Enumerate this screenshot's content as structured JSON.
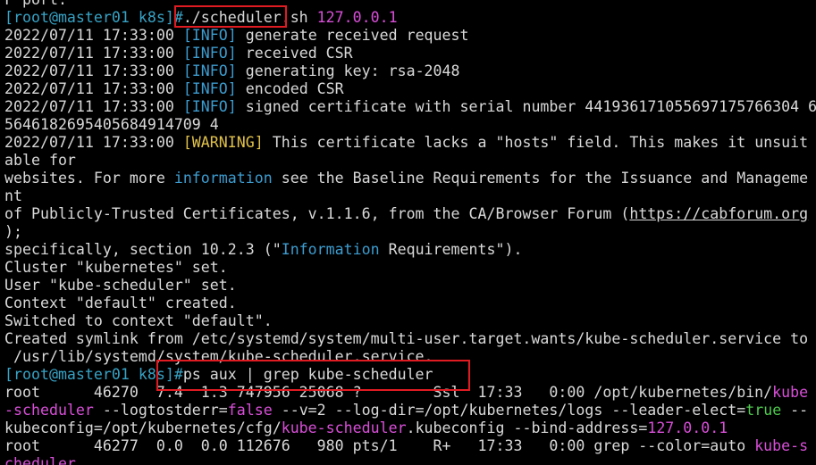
{
  "terminal": {
    "lines": [
      [
        {
          "t": "F port:"
        }
      ],
      [
        {
          "t": "[root@master01 k8s]#",
          "c": "cyan"
        },
        {
          "t": "./scheduler.sh "
        },
        {
          "t": "127.0.0.1",
          "c": "mag"
        }
      ],
      [
        {
          "t": "2022/07/11 17:33:00 "
        },
        {
          "t": "[INFO]",
          "c": "blue"
        },
        {
          "t": " generate received request"
        }
      ],
      [
        {
          "t": "2022/07/11 17:33:00 "
        },
        {
          "t": "[INFO]",
          "c": "blue"
        },
        {
          "t": " received CSR"
        }
      ],
      [
        {
          "t": "2022/07/11 17:33:00 "
        },
        {
          "t": "[INFO]",
          "c": "blue"
        },
        {
          "t": " generating key: rsa-2048"
        }
      ],
      [
        {
          "t": "2022/07/11 17:33:00 "
        },
        {
          "t": "[INFO]",
          "c": "blue"
        },
        {
          "t": " encoded CSR"
        }
      ],
      [
        {
          "t": "2022/07/11 17:33:00 "
        },
        {
          "t": "[INFO]",
          "c": "blue"
        },
        {
          "t": " signed certificate with serial number 441936171055697175766304 6"
        }
      ],
      [
        {
          "t": "5646182695405684914709 4"
        }
      ],
      [
        {
          "t": "2022/07/11 17:33:00 "
        },
        {
          "t": "[WARNING]",
          "c": "yel"
        },
        {
          "t": " This certificate lacks a \"hosts\" field. This makes it unsuit"
        }
      ],
      [
        {
          "t": "able for"
        }
      ],
      [
        {
          "t": "websites. For more "
        },
        {
          "t": "information",
          "c": "blue"
        },
        {
          "t": " see the Baseline Requirements for the Issuance and Manageme"
        }
      ],
      [
        {
          "t": "nt"
        }
      ],
      [
        {
          "t": "of Publicly-Trusted Certificates, v.1.1.6, from the CA/Browser Forum ("
        },
        {
          "t": "https://cabforum.org",
          "c": "ul"
        }
      ],
      [
        {
          "t": ");"
        }
      ],
      [
        {
          "t": "specifically, section 10.2.3 (\""
        },
        {
          "t": "Information",
          "c": "blue"
        },
        {
          "t": " Requirements\")."
        }
      ],
      [
        {
          "t": "Cluster \"kubernetes\" set."
        }
      ],
      [
        {
          "t": "User \"kube-scheduler\" set."
        }
      ],
      [
        {
          "t": "Context \"default\" created."
        }
      ],
      [
        {
          "t": "Switched to context \"default\"."
        }
      ],
      [
        {
          "t": "Created symlink from /etc/systemd/system/multi-user.target.wants/kube-scheduler.service to"
        }
      ],
      [
        {
          "t": " /usr/lib/systemd/system/kube-scheduler.service."
        }
      ],
      [
        {
          "t": "[root@master01 k8s]#",
          "c": "cyan"
        },
        {
          "t": "ps aux | grep kube-scheduler"
        }
      ],
      [
        {
          "t": "root      46270  7.4  1.3 747956 25068 ?        Ssl  17:33   0:00 /opt/kubernetes/bin/"
        },
        {
          "t": "kube",
          "c": "mag"
        }
      ],
      [
        {
          "t": "-scheduler",
          "c": "mag"
        },
        {
          "t": " --logtostderr="
        },
        {
          "t": "false",
          "c": "mag"
        },
        {
          "t": " --v=2 --log-dir=/opt/kubernetes/logs --leader-elect="
        },
        {
          "t": "true",
          "c": "green"
        },
        {
          "t": " --"
        }
      ],
      [
        {
          "t": "kubeconfig=/opt/kubernetes/cfg/"
        },
        {
          "t": "kube-scheduler",
          "c": "mag"
        },
        {
          "t": ".kubeconfig --bind-address="
        },
        {
          "t": "127.0.0.1",
          "c": "mag"
        }
      ],
      [
        {
          "t": "root      46277  0.0  0.0 112676   980 pts/1    R+   17:33   0:00 grep --color=auto "
        },
        {
          "t": "kube-s",
          "c": "mag"
        }
      ],
      [
        {
          "t": "cheduler",
          "c": "mag"
        }
      ]
    ]
  }
}
